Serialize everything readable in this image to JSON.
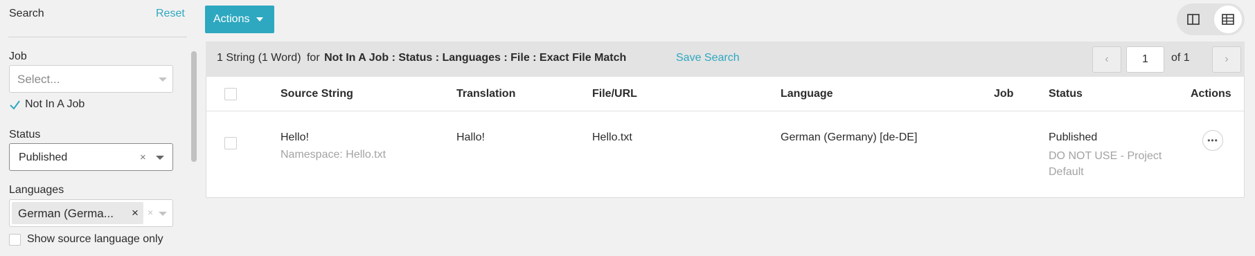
{
  "sidebar": {
    "title": "Search",
    "reset_label": "Reset",
    "job": {
      "label": "Job",
      "placeholder": "Select...",
      "not_in_job_label": "Not In A Job",
      "not_in_job_checked": true
    },
    "status": {
      "label": "Status",
      "value": "Published",
      "clear_glyph": "×"
    },
    "languages": {
      "label": "Languages",
      "chip_text": "German (Germa...",
      "chip_remove_glyph": "×",
      "clear_glyph": "×",
      "show_source_only_label": "Show source language only",
      "show_source_only_checked": false
    }
  },
  "toolbar": {
    "actions_label": "Actions",
    "view_toggle": {
      "icons": [
        "split-view-icon",
        "grid-view-icon"
      ],
      "active": "grid-view-icon"
    }
  },
  "results": {
    "count_text": "1 String (1 Word)",
    "for_text": "for",
    "filter_text": "Not In A Job : Status : Languages : File : Exact File Match",
    "save_search_label": "Save Search",
    "pager": {
      "prev_glyph": "‹",
      "next_glyph": "›",
      "page": "1",
      "of_text": "of 1"
    }
  },
  "table": {
    "columns": [
      "Source String",
      "Translation",
      "File/URL",
      "Language",
      "Job",
      "Status",
      "Actions"
    ],
    "rows": [
      {
        "source": "Hello!",
        "namespace": "Namespace: Hello.txt",
        "translation": "Hallo!",
        "file": "Hello.txt",
        "language": "German (Germany) [de-DE]",
        "job": "",
        "status": "Published",
        "status_sub": "DO NOT USE - Project Default",
        "more_glyph": "•••"
      }
    ]
  },
  "colors": {
    "accent": "#2ea8c0",
    "background": "#f1f1f1",
    "muted_text": "#a3a3a3"
  }
}
